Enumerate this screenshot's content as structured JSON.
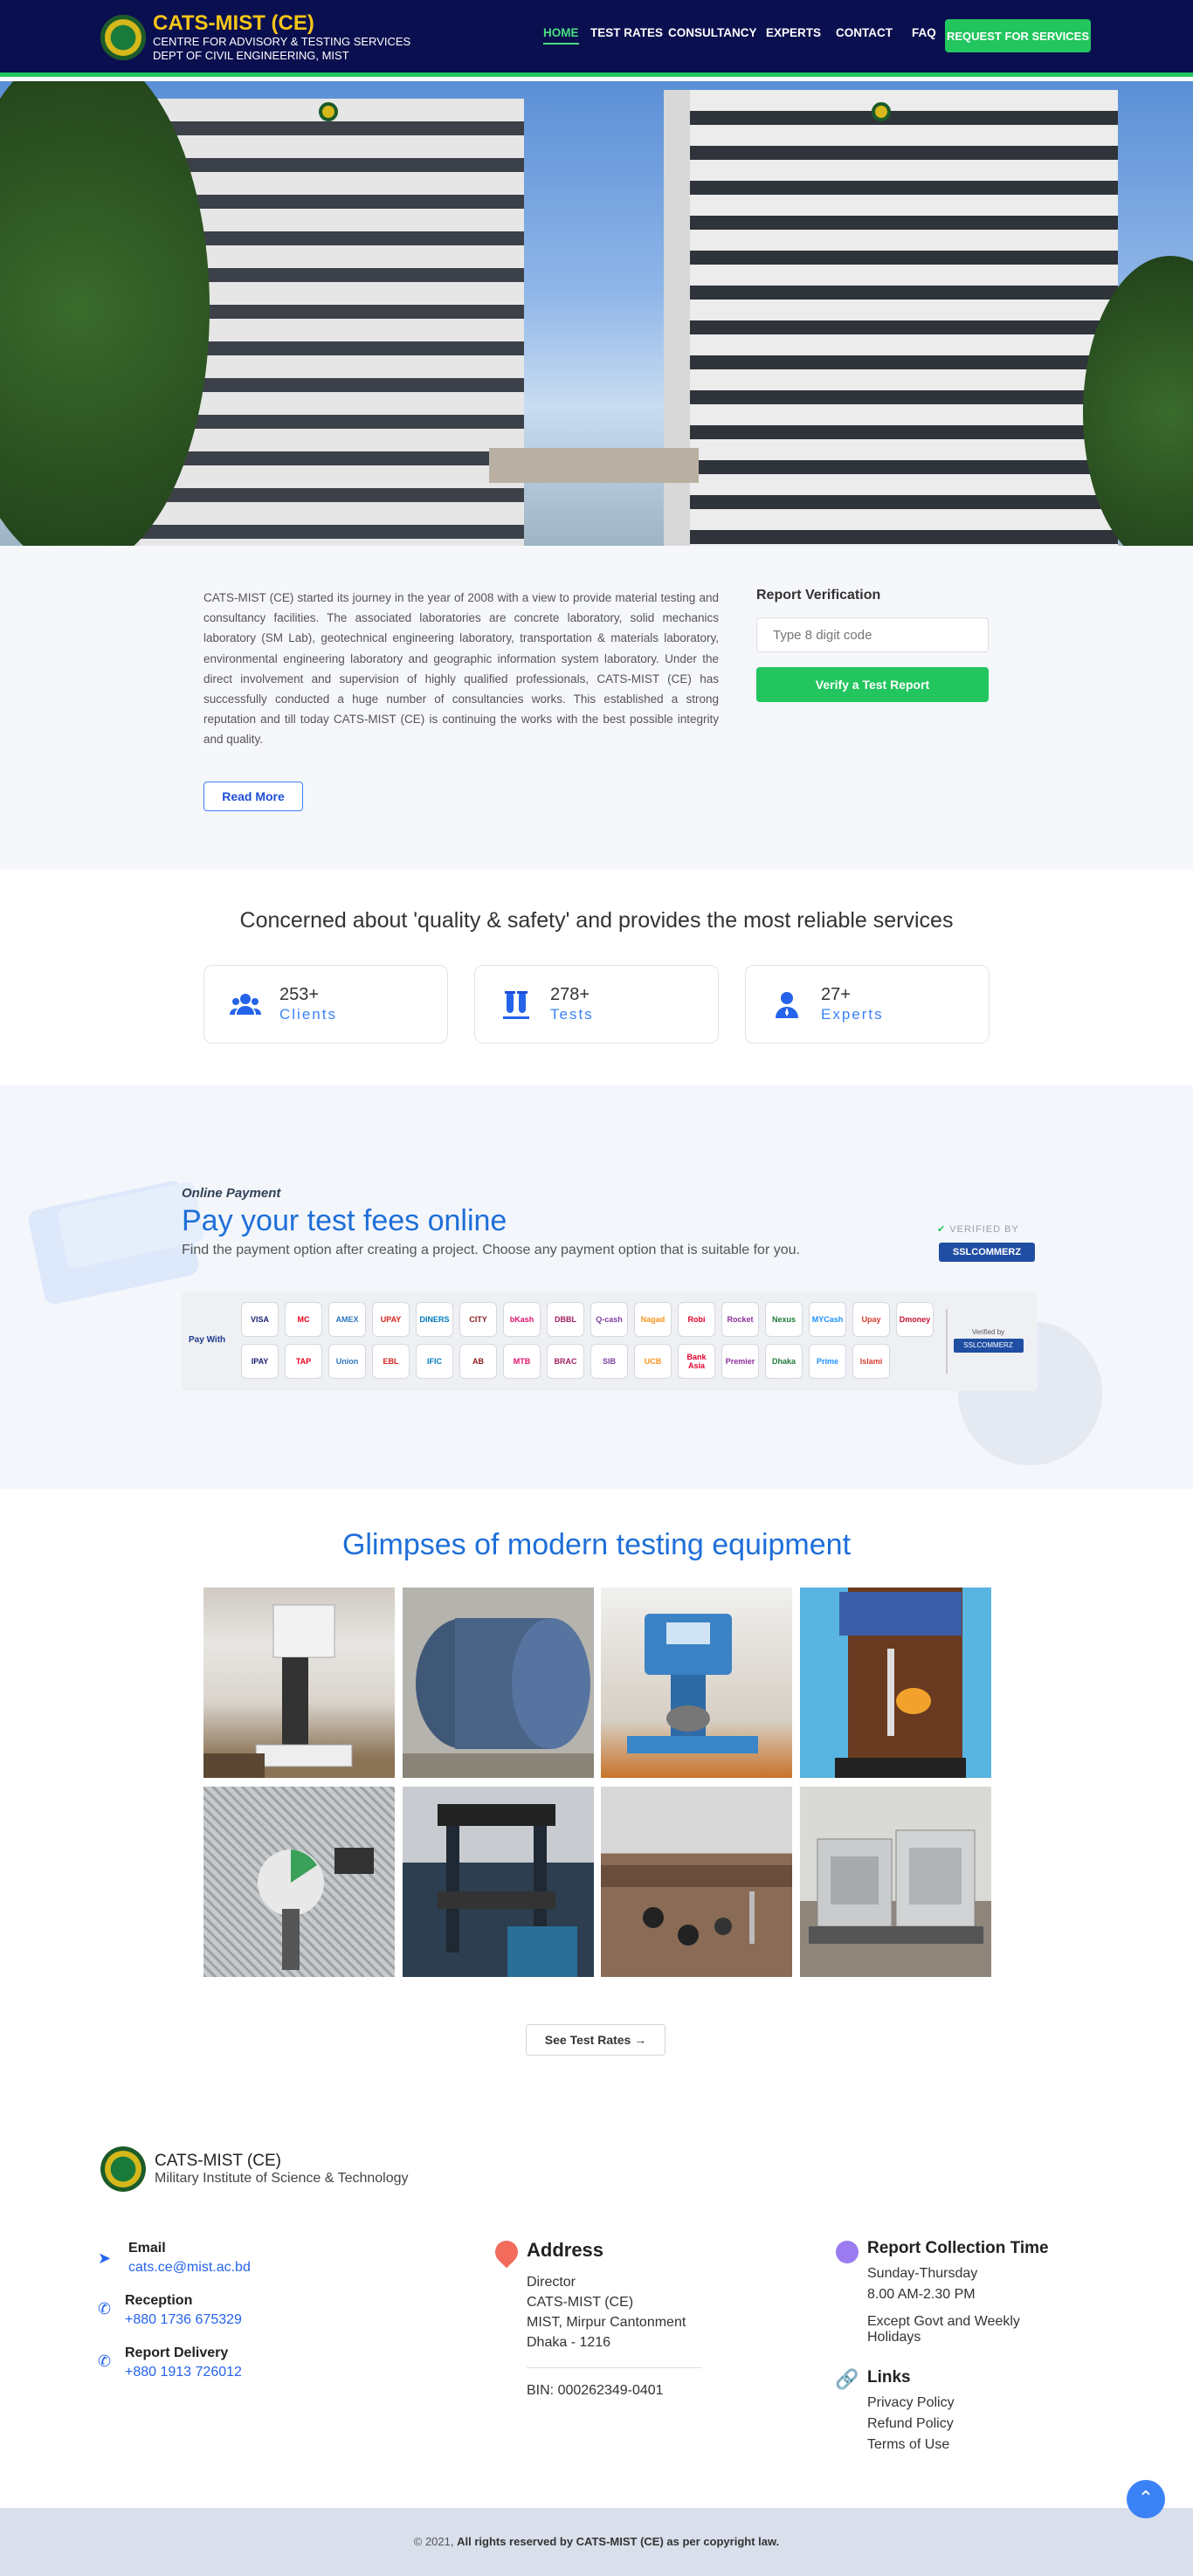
{
  "header": {
    "brand_title": "CATS-MIST (CE)",
    "brand_sub1": "CENTRE FOR ADVISORY & TESTING SERVICES",
    "brand_sub2": "DEPT OF CIVIL ENGINEERING, MIST",
    "nav": [
      "HOME",
      "TEST RATES",
      "CONSULTANCY",
      "EXPERTS",
      "CONTACT",
      "FAQ"
    ],
    "active_nav": "HOME",
    "cta": "REQUEST FOR SERVICES"
  },
  "about": {
    "text": "CATS-MIST (CE) started its journey in the year of 2008 with a view to provide material testing and consultancy facilities. The associated laboratories are concrete laboratory, solid mechanics laboratory (SM Lab), geotechnical engineering laboratory, transportation & materials laboratory, environmental engineering laboratory and geographic information system laboratory. Under the direct involvement and supervision of highly qualified professionals, CATS-MIST (CE) has successfully conducted a huge number of consultancies works. This established a strong reputation and till today CATS-MIST (CE) is continuing the works with the best possible integrity and quality.",
    "read_more": "Read More"
  },
  "verification": {
    "title": "Report Verification",
    "placeholder": "Type 8 digit code",
    "button": "Verify a Test Report"
  },
  "quality": {
    "title": "Concerned about 'quality & safety' and provides the most reliable services",
    "stats": [
      {
        "icon": "users-icon",
        "value": "253+",
        "label": "Clients"
      },
      {
        "icon": "test-tubes-icon",
        "value": "278+",
        "label": "Tests"
      },
      {
        "icon": "expert-icon",
        "value": "27+",
        "label": "Experts"
      }
    ]
  },
  "payment": {
    "tag": "Online Payment",
    "title": "Pay your test fees online",
    "subtitle": "Find the payment option after creating a project. Choose any payment option that is suitable for you.",
    "verified_by": "VERIFIED BY",
    "ssl": "SSLCOMMERZ",
    "pay_with": "Pay With",
    "methods_row1": [
      "VISA",
      "MC",
      "AMEX",
      "UPAY",
      "DINERS",
      "CITY",
      "bKash",
      "DBBL",
      "Q-cash",
      "Nagad",
      "Robi",
      "Rocket",
      "Nexus",
      "MYCash",
      "Upay",
      "Dmoney"
    ],
    "methods_row2": [
      "IPAY",
      "TAP",
      "Union",
      "EBL",
      "IFIC",
      "AB",
      "MTB",
      "BRAC",
      "SIB",
      "UCB",
      "Bank Asia",
      "Premier",
      "Dhaka",
      "Prime",
      "Islami"
    ],
    "powered_by": "Verified by",
    "colors": {
      "accent": "#1e6fd9",
      "green": "#22c55e",
      "navy": "#0a0f4f"
    }
  },
  "gallery": {
    "title": "Glimpses of modern testing equipment",
    "images": [
      "hardness-tester",
      "los-angeles-abrasion-machine",
      "blue-test-apparatus",
      "wooden-cabinet-apparatus",
      "impact-tester",
      "universal-testing-machine",
      "lab-bench-samples",
      "oven-furnaces"
    ],
    "see_rates": "See Test Rates →"
  },
  "footer": {
    "org": "CATS-MIST (CE)",
    "org_sub": "Military Institute of Science & Technology",
    "email_label": "Email",
    "email": "cats.ce@mist.ac.bd",
    "reception_label": "Reception",
    "reception": "+880 1736 675329",
    "delivery_label": "Report Delivery",
    "delivery": "+880 1913 726012",
    "address_title": "Address",
    "address": [
      "Director",
      "CATS-MIST (CE)",
      "MIST, Mirpur Cantonment",
      "Dhaka - 1216"
    ],
    "bin": "BIN: 000262349-0401",
    "collection_title": "Report Collection Time",
    "collection_days": "Sunday-Thursday",
    "collection_hours": "8.00 AM-2.30 PM",
    "collection_note": "Except Govt and Weekly Holidays",
    "links_title": "Links",
    "links": [
      "Privacy Policy",
      "Refund Policy",
      "Terms of Use"
    ],
    "copyright_pre": "© 2021,",
    "copyright": "All rights reserved by CATS-MIST (CE) as per copyright law."
  }
}
